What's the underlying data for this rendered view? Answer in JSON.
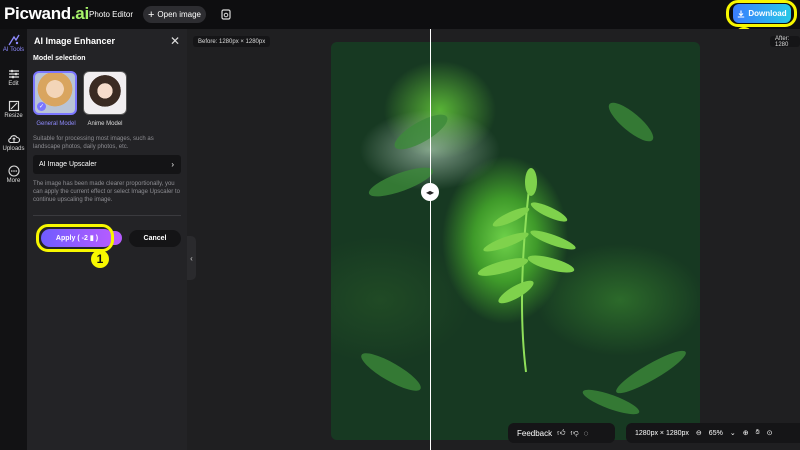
{
  "topbar": {
    "logo_main": "Picwand",
    "logo_ai": ".ai",
    "photo_editor": "Photo Editor",
    "open_image": "Open image",
    "download": "Download"
  },
  "rail": [
    {
      "label": "AI Tools",
      "icon": "ai-tools-icon"
    },
    {
      "label": "Edit",
      "icon": "sliders-icon"
    },
    {
      "label": "Resize",
      "icon": "resize-icon"
    },
    {
      "label": "Uploads",
      "icon": "upload-icon"
    },
    {
      "label": "More",
      "icon": "more-icon"
    }
  ],
  "panel": {
    "title": "AI Image Enhancer",
    "section": "Model selection",
    "models": [
      {
        "label": "General Model",
        "selected": true
      },
      {
        "label": "Anime Model",
        "selected": false
      }
    ],
    "description": "Suitable for processing most images, such as landscape photos, daily photos, etc.",
    "upscaler": "AI Image Upscaler",
    "note": "The image has been made clearer proportionally, you can apply the current effect or select Image Upscaler to continue upscaling the image.",
    "apply": "Apply",
    "apply_cost": "( -2",
    "apply_close": ")",
    "cancel": "Cancel"
  },
  "canvas": {
    "before_tag": "Before: 1280px × 1280px",
    "after_tag": "After: 1280",
    "feedback": "Feedback",
    "dimensions": "1280px × 1280px",
    "zoom": "65%"
  },
  "annotations": {
    "badge_1": "1",
    "badge_2": "2"
  },
  "colors": {
    "accent": "#7b76ff",
    "highlight": "#f7f700",
    "logo_ai": "#a7f36b"
  }
}
